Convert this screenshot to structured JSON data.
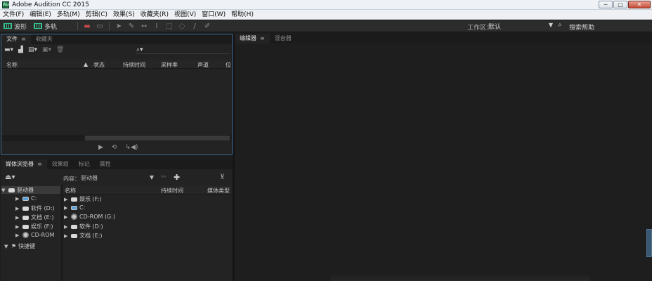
{
  "titlebar": {
    "app_icon": "Au",
    "title": "Adobe Audition CC 2015",
    "minimize": "─",
    "maximize": "□",
    "close": "✕"
  },
  "menubar": {
    "items": [
      {
        "label": "文件(F)"
      },
      {
        "label": "编辑(E)"
      },
      {
        "label": "多轨(M)"
      },
      {
        "label": "剪辑(C)"
      },
      {
        "label": "效果(S)"
      },
      {
        "label": "收藏夹(R)"
      },
      {
        "label": "视图(V)"
      },
      {
        "label": "窗口(W)"
      },
      {
        "label": "帮助(H)"
      }
    ]
  },
  "toolbar": {
    "waveform_label": "波形",
    "multitrack_label": "多轨",
    "workspace_label": "工作区：",
    "workspace_value": "默认",
    "help_search": "搜索帮助"
  },
  "files_panel": {
    "tabs": [
      {
        "label": "文件",
        "active": true
      },
      {
        "label": "收藏夹",
        "active": false
      }
    ],
    "columns": [
      "名称",
      "状态",
      "持续时间",
      "采样率",
      "声道",
      "位"
    ]
  },
  "media_panel": {
    "tabs": [
      {
        "label": "媒体浏览器",
        "active": true
      },
      {
        "label": "效果组",
        "active": false
      },
      {
        "label": "标记",
        "active": false
      },
      {
        "label": "属性",
        "active": false
      }
    ],
    "content_label": "内容：",
    "content_value": "驱动器",
    "columns": [
      "名称",
      "持续时间",
      "媒体类型"
    ],
    "tree": [
      {
        "label": "驱动器",
        "expanded": true
      },
      {
        "label": "C:"
      },
      {
        "label": "软件 (D:)"
      },
      {
        "label": "文档 (E:)"
      },
      {
        "label": "娱乐 (F:)"
      },
      {
        "label": "CD-ROM"
      },
      {
        "label": "快捷键"
      }
    ],
    "list": [
      {
        "label": "娱乐 (F:)"
      },
      {
        "label": "C:"
      },
      {
        "label": "CD-ROM (G:)"
      },
      {
        "label": "软件 (D:)"
      },
      {
        "label": "文档 (E:)"
      }
    ]
  },
  "editor_panel": {
    "tabs": [
      {
        "label": "编辑器",
        "active": true
      },
      {
        "label": "混音器",
        "active": false
      }
    ]
  },
  "colors": {
    "accent_blue": "#3d6a94",
    "waveform_green": "#36c38c",
    "background": "#1d1d1d"
  }
}
